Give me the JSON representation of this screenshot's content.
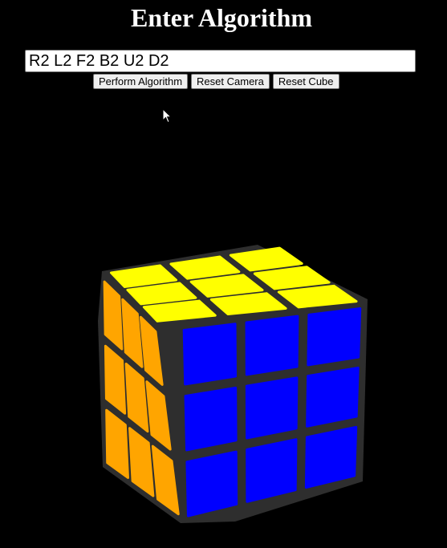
{
  "header": {
    "title": "Enter Algorithm"
  },
  "algorithm_input": {
    "value": "R2 L2 F2 B2 U2 D2"
  },
  "buttons": {
    "perform": "Perform Algorithm",
    "reset_camera": "Reset Camera",
    "reset_cube": "Reset Cube"
  },
  "cube": {
    "colors": {
      "top": "#ffff00",
      "left": "#ffa500",
      "front": "#0000ff",
      "body": "#2e2e2e"
    }
  },
  "icons": {
    "pointer": "mouse-pointer-icon"
  }
}
